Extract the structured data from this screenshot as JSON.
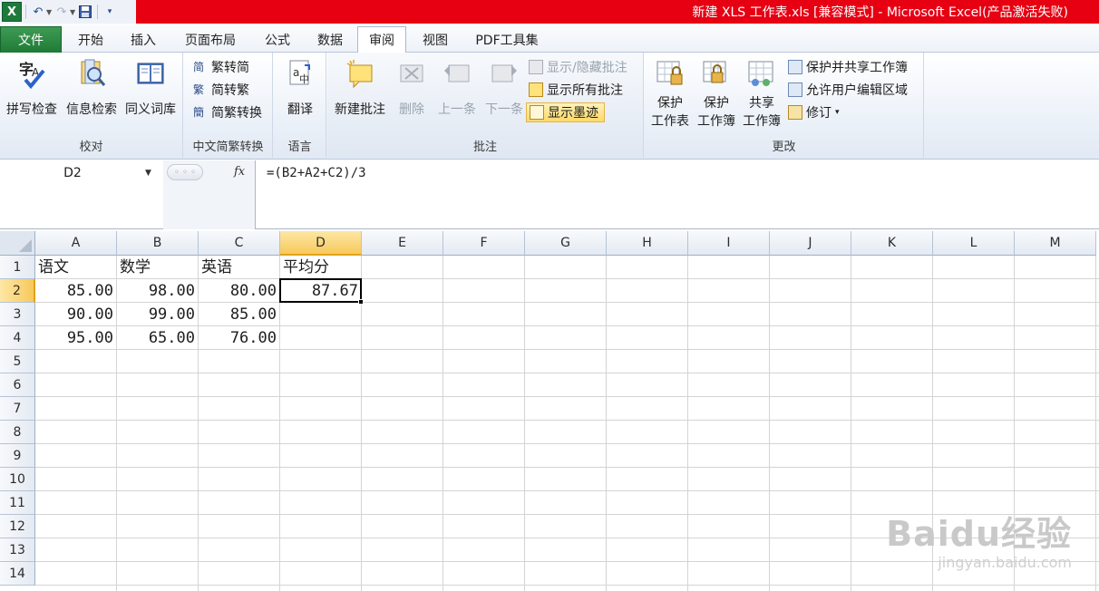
{
  "window": {
    "title": "新建 XLS 工作表.xls  [兼容模式] - Microsoft Excel(产品激活失败)"
  },
  "qat": {
    "logo": "X",
    "undo_icon": "undo-icon",
    "redo_icon": "redo-icon",
    "save_icon": "save-icon"
  },
  "tabs": {
    "file": "文件",
    "items": [
      "开始",
      "插入",
      "页面布局",
      "公式",
      "数据",
      "审阅",
      "视图",
      "PDF工具集"
    ],
    "active": "审阅"
  },
  "ribbon": {
    "proofing": {
      "label": "校对",
      "spell": "拼写检查",
      "research": "信息检索",
      "thesaurus": "同义词库"
    },
    "chinese": {
      "label": "中文简繁转换",
      "to_trad": "繁转简",
      "to_simp": "简转繁",
      "convert": "简繁转换"
    },
    "language": {
      "label": "语言",
      "translate": "翻译"
    },
    "comments": {
      "label": "批注",
      "new": "新建批注",
      "delete": "删除",
      "prev": "上一条",
      "next": "下一条",
      "show_hide": "显示/隐藏批注",
      "show_all": "显示所有批注",
      "show_ink": "显示墨迹"
    },
    "changes": {
      "label": "更改",
      "protect_sheet_1": "保护",
      "protect_sheet_2": "工作表",
      "protect_book_1": "保护",
      "protect_book_2": "工作簿",
      "share_book_1": "共享",
      "share_book_2": "工作簿",
      "protect_share": "保护并共享工作簿",
      "allow_edit": "允许用户编辑区域",
      "track": "修订"
    }
  },
  "formula_bar": {
    "name_box": "D2",
    "fx": "fx",
    "formula": "=(B2+A2+C2)/3"
  },
  "sheet": {
    "columns": [
      "A",
      "B",
      "C",
      "D",
      "E",
      "F",
      "G",
      "H",
      "I",
      "J",
      "K",
      "L",
      "M"
    ],
    "rows": [
      "1",
      "2",
      "3",
      "4",
      "5",
      "6",
      "7",
      "8",
      "9",
      "10",
      "11",
      "12",
      "13",
      "14"
    ],
    "selected_column": "D",
    "selected_row": "2",
    "cells": {
      "A1": "语文",
      "B1": "数学",
      "C1": "英语",
      "D1": "平均分",
      "A2": "85.00",
      "B2": "98.00",
      "C2": "80.00",
      "D2": "87.67",
      "A3": "90.00",
      "B3": "99.00",
      "C3": "85.00",
      "A4": "95.00",
      "B4": "65.00",
      "C4": "76.00"
    }
  },
  "watermark": {
    "brand": "Baidu经验",
    "url": "jingyan.baidu.com"
  }
}
